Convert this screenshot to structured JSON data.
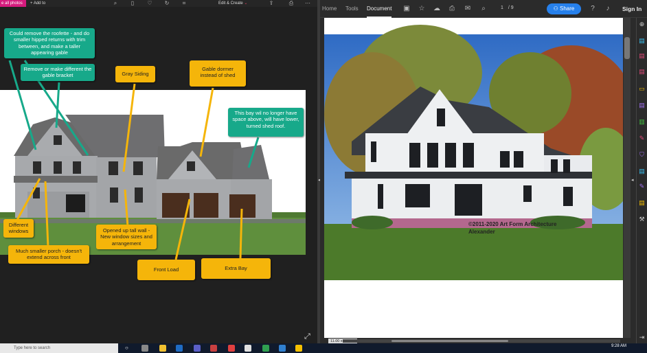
{
  "left_window": {
    "all_photos": "e all photos",
    "add_to": "Add to",
    "edit_create": "Edit & Create",
    "callouts": {
      "roofette": "Could remove the roofette - and do smaller hipped returns with trim between, and make a taller appearing gable",
      "bracket": "Remove or make different the gable bracket",
      "gray_siding": "Gray Siding",
      "gable_dormer": "Gable dormer instead of shed",
      "bay": "This bay wil no longer have space above, will have lower, turned shed roof.",
      "windows": "Different windows",
      "porch": "Much smaller porch - doesn't extend across front",
      "tall_wall": "Opened up tall wall - New window sizes and arrangement",
      "front_load": "Front Load",
      "extra_bay": "Extra Bay"
    }
  },
  "right_window": {
    "tabs": [
      "Home",
      "Tools",
      "Document"
    ],
    "active_tab": "Document",
    "page_current": "1",
    "page_total": "/ 9",
    "share": "Share",
    "sign_in": "Sign In",
    "watermark": "©2011-2020 Art Form Architecture",
    "watermark_name": "Alexander",
    "page_size": "11.00 x 8.50 in"
  },
  "taskbar": {
    "search_placeholder": "Type here to search",
    "time": "9:28 AM"
  },
  "colors": {
    "teal": "#17a98a",
    "yellow": "#f5b50a",
    "share_blue": "#2680eb",
    "pink": "#d51b7d"
  }
}
